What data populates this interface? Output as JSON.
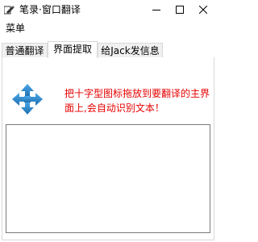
{
  "window": {
    "title": "笔录·窗口翻译",
    "app_icon": "pen-icon",
    "controls": {
      "minimize_icon": "minimize-icon",
      "maximize_icon": "maximize-icon",
      "close_icon": "close-icon"
    }
  },
  "menubar": {
    "items": [
      {
        "label": "菜单"
      }
    ]
  },
  "tabs": [
    {
      "label": "普通翻译",
      "selected": false
    },
    {
      "label": "界面提取",
      "selected": true
    },
    {
      "label": "给Jack发信息",
      "selected": false
    }
  ],
  "panel": {
    "drag_icon": "move-arrows-icon",
    "hint": "把十字型图标拖放到要翻译的主界面上,会自动识别文本！",
    "result_value": ""
  },
  "colors": {
    "hint_text": "#e60000",
    "drag_icon": "#2f8bd0",
    "tab_border": "#d9d9d9"
  }
}
